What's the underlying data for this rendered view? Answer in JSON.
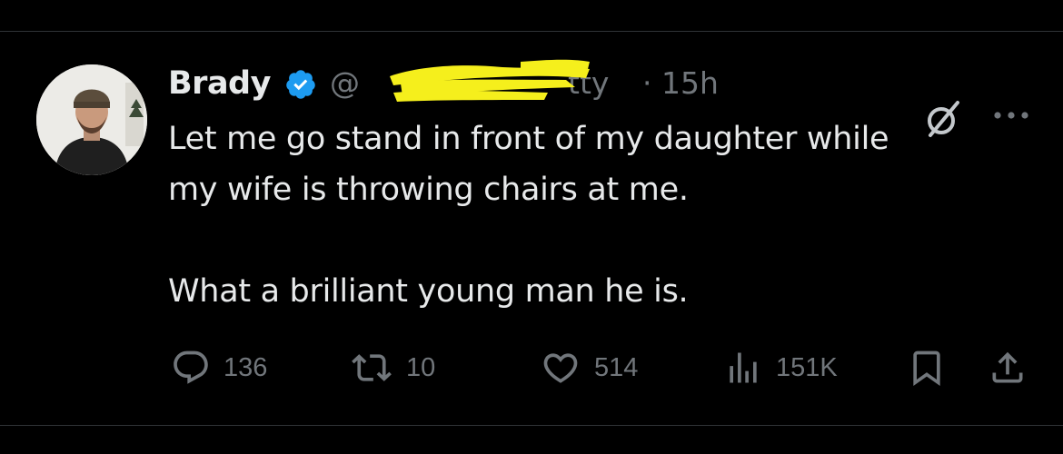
{
  "tweet": {
    "author_name": "Brady",
    "verified": true,
    "handle_visible": "@",
    "handle_tail_visible": "tty",
    "timestamp": "· 15h",
    "text": "Let me go stand in front of my daughter while\nmy wife is throwing chairs at me.\n\nWhat a brilliant young man he is.",
    "icons": {
      "verified": "verified-badge-icon",
      "grok": "grok-icon",
      "more": "more-options-icon",
      "reply": "reply-icon",
      "retweet": "retweet-icon",
      "like": "heart-icon",
      "views": "views-icon",
      "bookmark": "bookmark-icon",
      "share": "share-icon"
    },
    "stats": {
      "replies": "136",
      "retweets": "10",
      "likes": "514",
      "views": "151K"
    }
  },
  "colors": {
    "background": "#000000",
    "text_primary": "#e7e9ea",
    "text_secondary": "#71767b",
    "verified_blue": "#1d9bf0",
    "redaction_yellow": "#f5ef1c",
    "divider": "#2f3336"
  }
}
